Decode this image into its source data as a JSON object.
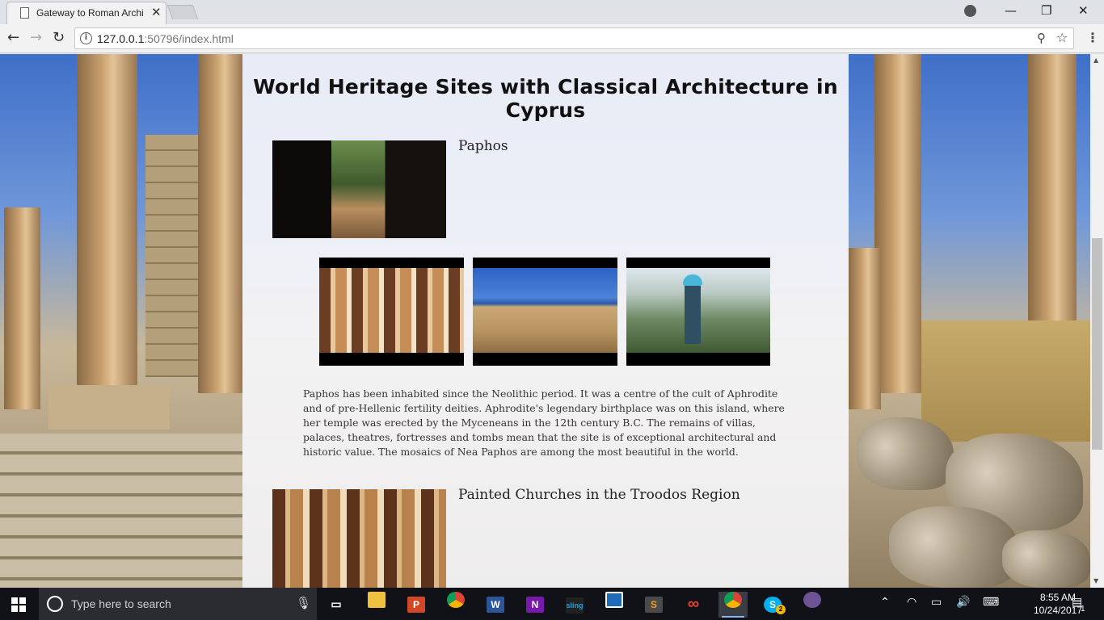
{
  "browser": {
    "tab_title": "Gateway to Roman Archi",
    "tab_close": "✕",
    "url_host": "127.0.0.1",
    "url_rest": ":50796/index.html",
    "minimize": "—",
    "maximize": "❐",
    "close": "✕"
  },
  "page": {
    "heading": "World Heritage Sites with Classical Architecture in Cyprus",
    "sites": [
      {
        "name": "Paphos",
        "description": "Paphos has been inhabited since the Neolithic period. It was a centre of the cult of Aphrodite and of pre-Hellenic fertility deities. Aphrodite's legendary birthplace was on this island, where her temple was erected by the Myceneans in the 12th century B.C. The remains of villas, palaces, theatres, fortresses and tombs mean that the site is of exceptional architectural and historic value. The mosaics of Nea Paphos are among the most beautiful in the world."
      },
      {
        "name": "Painted Churches in the Troodos Region"
      }
    ]
  },
  "taskbar": {
    "search_placeholder": "Type here to search",
    "time": "8:55 AM",
    "date": "10/24/2017",
    "notification_count": "1",
    "skype_badge": "2",
    "apps": [
      {
        "label": "P",
        "color": "#d24726"
      },
      {
        "label": "W",
        "color": "#2b579a"
      },
      {
        "label": "N",
        "color": "#7719aa"
      },
      {
        "label": "sling",
        "color": "#1aa3e0"
      },
      {
        "label": "S",
        "color": "#4a4a4a"
      },
      {
        "label": "S",
        "color": "#00aff0"
      }
    ]
  }
}
